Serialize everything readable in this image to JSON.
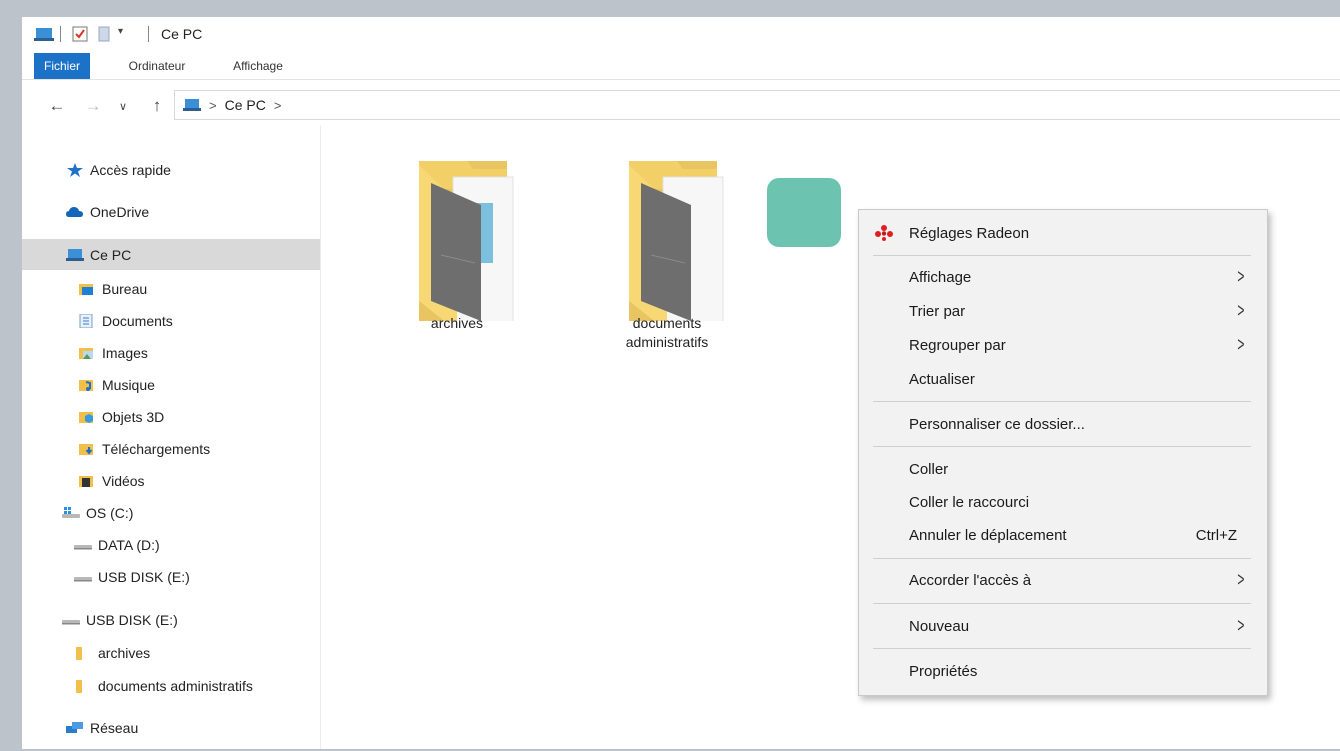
{
  "window": {
    "title": "Ce PC"
  },
  "ribbon": {
    "tabs": [
      "Fichier",
      "Ordinateur",
      "Affichage"
    ]
  },
  "address": {
    "path": [
      "Ce PC"
    ]
  },
  "sidebar": {
    "quick_access": "Accès rapide",
    "onedrive": "OneDrive",
    "this_pc": "Ce PC",
    "pc_items": [
      "Bureau",
      "Documents",
      "Images",
      "Musique",
      "Objets 3D",
      "Téléchargements",
      "Vidéos",
      "OS (C:)",
      "DATA (D:)",
      "USB DISK (E:)"
    ],
    "usb": "USB DISK (E:)",
    "usb_items": [
      "archives",
      "documents administratifs"
    ],
    "network": "Réseau"
  },
  "content": {
    "folders": [
      {
        "label": "archives"
      },
      {
        "label": "documents administratifs",
        "label_line1": "documents",
        "label_line2": "administratifs"
      }
    ]
  },
  "context_menu": {
    "radeon": "Réglages Radeon",
    "affichage": "Affichage",
    "trier": "Trier par",
    "regrouper": "Regrouper par",
    "actualiser": "Actualiser",
    "personnaliser": "Personnaliser ce dossier...",
    "coller": "Coller",
    "coller_raccourci": "Coller le raccourci",
    "annuler": "Annuler le déplacement",
    "annuler_shortcut": "Ctrl+Z",
    "accorder": "Accorder l'accès à",
    "nouveau": "Nouveau",
    "proprietes": "Propriétés"
  },
  "colors": {
    "file_tab": "#1b72c7",
    "folder": "#f8d775",
    "new_item": "#6cc3b0",
    "menu_bg": "#f2f2f2"
  }
}
